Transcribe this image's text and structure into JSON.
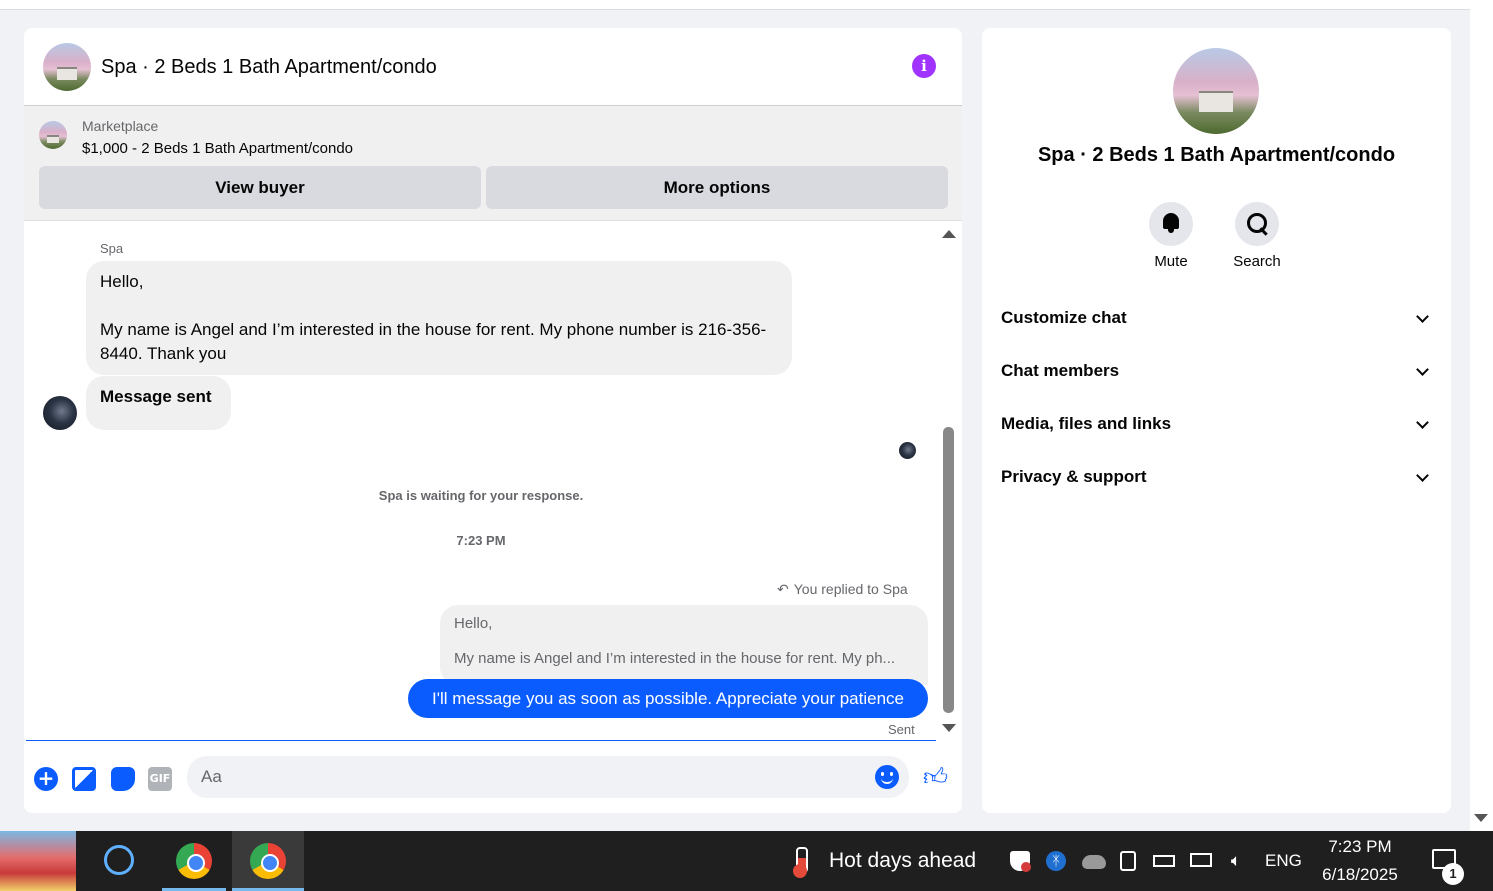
{
  "chat": {
    "title": "Spa · 2 Beds 1 Bath Apartment/condo",
    "marketplace": {
      "label": "Marketplace",
      "item": "$1,000 - 2 Beds 1 Bath Apartment/condo",
      "view_buyer": "View buyer",
      "more_options": "More options"
    },
    "messages": {
      "sender": "Spa",
      "incoming_line1": "Hello,",
      "incoming_line2": "My name is Angel and I’m interested in the house for rent. My phone number is 216-356-8440. Thank you",
      "message_sent": "Message sent",
      "waiting": "Spa is waiting for your response.",
      "timestamp": "7:23 PM",
      "replied_to": "You replied to Spa",
      "quoted_line1": "Hello,",
      "quoted_line2": "My name is Angel and I’m interested in the house for rent. My ph...",
      "outgoing": "I'll message you as soon as possible. Appreciate your patience",
      "status": "Sent"
    },
    "composer": {
      "placeholder": "Aa",
      "gif": "GIF"
    }
  },
  "info_panel": {
    "title": "Spa · 2 Beds 1 Bath Apartment/condo",
    "actions": [
      {
        "label": "Mute",
        "icon": "bell-icon"
      },
      {
        "label": "Search",
        "icon": "search-icon"
      }
    ],
    "sections": [
      {
        "label": "Customize chat"
      },
      {
        "label": "Chat members"
      },
      {
        "label": "Media, files and links"
      },
      {
        "label": "Privacy & support"
      }
    ]
  },
  "taskbar": {
    "weather": "Hot days ahead",
    "language": "ENG",
    "time": "7:23 PM",
    "date": "6/18/2025",
    "notification_count": "1"
  },
  "colors": {
    "accent_blue": "#0a5cff",
    "info_purple": "#a033ff",
    "bubble_gray": "#f0f0f0"
  }
}
